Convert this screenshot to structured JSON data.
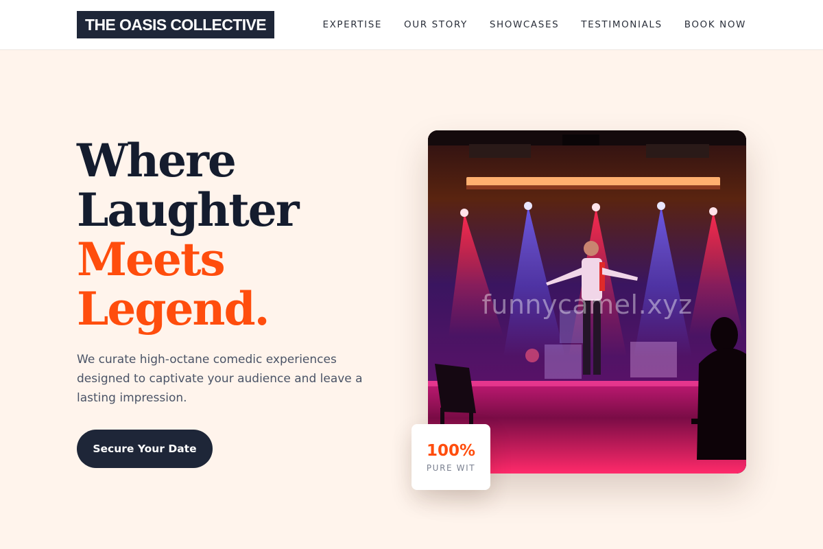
{
  "brand": {
    "name": "THE OASIS COLLECTIVE"
  },
  "nav": {
    "items": [
      {
        "label": "EXPERTISE"
      },
      {
        "label": "OUR STORY"
      },
      {
        "label": "SHOWCASES"
      },
      {
        "label": "TESTIMONIALS"
      },
      {
        "label": "BOOK NOW"
      }
    ]
  },
  "hero": {
    "headline_lines": [
      "Where",
      "Laughter",
      "Meets",
      "Legend."
    ],
    "description": "We curate high-octane comedic experiences designed to captivate your audience and leave a lasting impression.",
    "cta_label": "Secure Your Date"
  },
  "image": {
    "watermark": "funnycamel.xyz"
  },
  "stat": {
    "value": "100%",
    "label": "PURE WIT"
  },
  "colors": {
    "accent": "#ff4d0d",
    "navy": "#1e2638",
    "background": "#fff4ec"
  }
}
